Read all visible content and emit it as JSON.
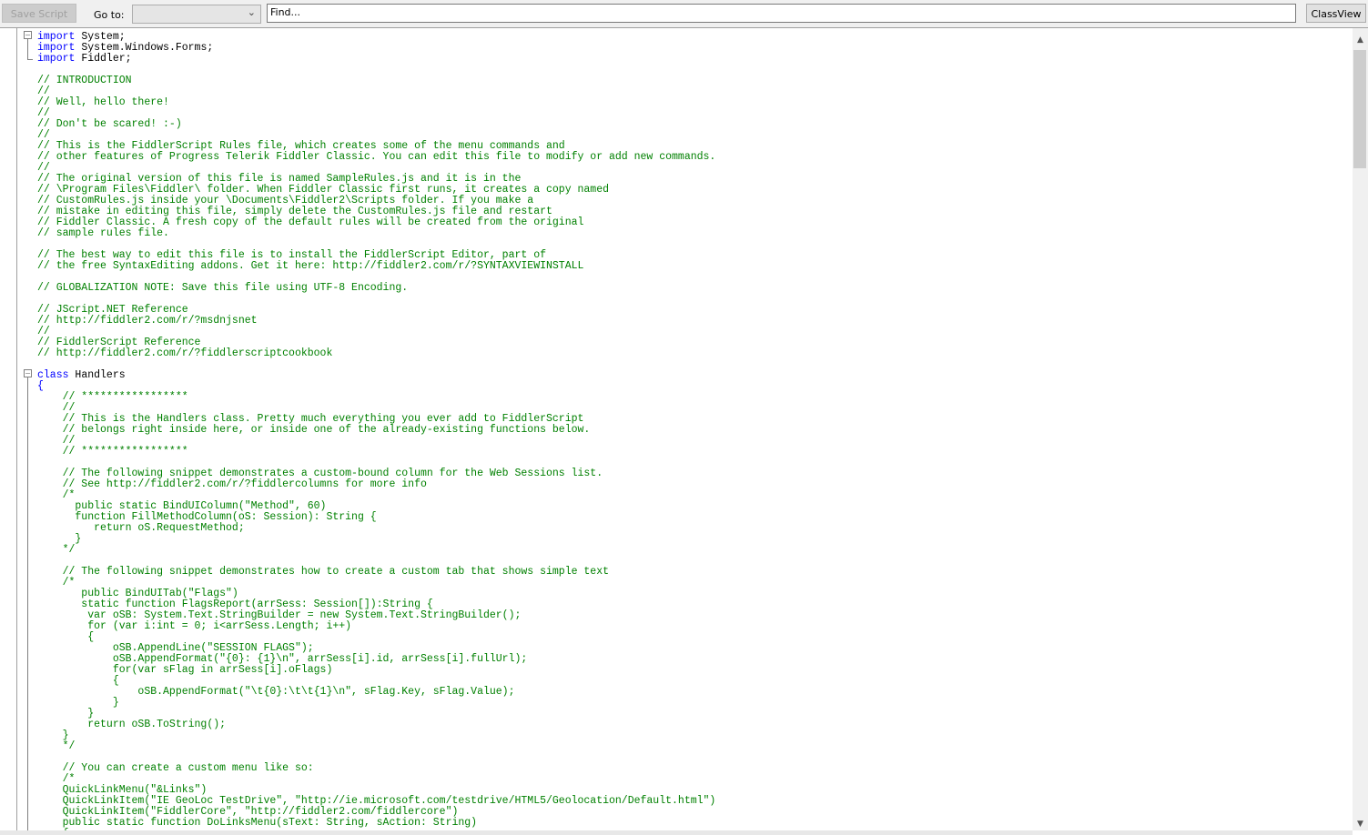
{
  "toolbar": {
    "save_label": "Save Script",
    "goto_label": "Go to:",
    "goto_value": "",
    "find_placeholder": "Find...",
    "classview_label": "ClassView"
  },
  "colors": {
    "keyword": "#0000ff",
    "comment": "#008000",
    "text": "#000000"
  },
  "editor": {
    "lines": [
      {
        "k": "import",
        "t": " System;",
        "c": ""
      },
      {
        "k": "import",
        "t": " System.Windows.Forms;",
        "c": ""
      },
      {
        "k": "import",
        "t": " Fiddler;",
        "c": ""
      },
      {
        "k": "",
        "t": "",
        "c": ""
      },
      {
        "k": "",
        "t": "",
        "c": "// INTRODUCTION"
      },
      {
        "k": "",
        "t": "",
        "c": "//"
      },
      {
        "k": "",
        "t": "",
        "c": "// Well, hello there!"
      },
      {
        "k": "",
        "t": "",
        "c": "//"
      },
      {
        "k": "",
        "t": "",
        "c": "// Don't be scared! :-)"
      },
      {
        "k": "",
        "t": "",
        "c": "//"
      },
      {
        "k": "",
        "t": "",
        "c": "// This is the FiddlerScript Rules file, which creates some of the menu commands and"
      },
      {
        "k": "",
        "t": "",
        "c": "// other features of Progress Telerik Fiddler Classic. You can edit this file to modify or add new commands."
      },
      {
        "k": "",
        "t": "",
        "c": "//"
      },
      {
        "k": "",
        "t": "",
        "c": "// The original version of this file is named SampleRules.js and it is in the"
      },
      {
        "k": "",
        "t": "",
        "c": "// \\Program Files\\Fiddler\\ folder. When Fiddler Classic first runs, it creates a copy named"
      },
      {
        "k": "",
        "t": "",
        "c": "// CustomRules.js inside your \\Documents\\Fiddler2\\Scripts folder. If you make a"
      },
      {
        "k": "",
        "t": "",
        "c": "// mistake in editing this file, simply delete the CustomRules.js file and restart"
      },
      {
        "k": "",
        "t": "",
        "c": "// Fiddler Classic. A fresh copy of the default rules will be created from the original"
      },
      {
        "k": "",
        "t": "",
        "c": "// sample rules file."
      },
      {
        "k": "",
        "t": "",
        "c": ""
      },
      {
        "k": "",
        "t": "",
        "c": "// The best way to edit this file is to install the FiddlerScript Editor, part of"
      },
      {
        "k": "",
        "t": "",
        "c": "// the free SyntaxEditing addons. Get it here: http://fiddler2.com/r/?SYNTAXVIEWINSTALL"
      },
      {
        "k": "",
        "t": "",
        "c": ""
      },
      {
        "k": "",
        "t": "",
        "c": "// GLOBALIZATION NOTE: Save this file using UTF-8 Encoding."
      },
      {
        "k": "",
        "t": "",
        "c": ""
      },
      {
        "k": "",
        "t": "",
        "c": "// JScript.NET Reference"
      },
      {
        "k": "",
        "t": "",
        "c": "// http://fiddler2.com/r/?msdnjsnet"
      },
      {
        "k": "",
        "t": "",
        "c": "//"
      },
      {
        "k": "",
        "t": "",
        "c": "// FiddlerScript Reference"
      },
      {
        "k": "",
        "t": "",
        "c": "// http://fiddler2.com/r/?fiddlerscriptcookbook"
      },
      {
        "k": "",
        "t": "",
        "c": ""
      },
      {
        "k": "class",
        "t": " Handlers",
        "c": ""
      },
      {
        "k": "{",
        "t": "",
        "c": ""
      },
      {
        "k": "",
        "t": "",
        "c": "    // *****************"
      },
      {
        "k": "",
        "t": "",
        "c": "    //"
      },
      {
        "k": "",
        "t": "",
        "c": "    // This is the Handlers class. Pretty much everything you ever add to FiddlerScript"
      },
      {
        "k": "",
        "t": "",
        "c": "    // belongs right inside here, or inside one of the already-existing functions below."
      },
      {
        "k": "",
        "t": "",
        "c": "    //"
      },
      {
        "k": "",
        "t": "",
        "c": "    // *****************"
      },
      {
        "k": "",
        "t": "",
        "c": ""
      },
      {
        "k": "",
        "t": "",
        "c": "    // The following snippet demonstrates a custom-bound column for the Web Sessions list."
      },
      {
        "k": "",
        "t": "",
        "c": "    // See http://fiddler2.com/r/?fiddlercolumns for more info"
      },
      {
        "k": "",
        "t": "",
        "c": "    /*"
      },
      {
        "k": "",
        "t": "",
        "c": "      public static BindUIColumn(\"Method\", 60)"
      },
      {
        "k": "",
        "t": "",
        "c": "      function FillMethodColumn(oS: Session): String {"
      },
      {
        "k": "",
        "t": "",
        "c": "         return oS.RequestMethod;"
      },
      {
        "k": "",
        "t": "",
        "c": "      }"
      },
      {
        "k": "",
        "t": "",
        "c": "    */"
      },
      {
        "k": "",
        "t": "",
        "c": ""
      },
      {
        "k": "",
        "t": "",
        "c": "    // The following snippet demonstrates how to create a custom tab that shows simple text"
      },
      {
        "k": "",
        "t": "",
        "c": "    /*"
      },
      {
        "k": "",
        "t": "",
        "c": "       public BindUITab(\"Flags\")"
      },
      {
        "k": "",
        "t": "",
        "c": "       static function FlagsReport(arrSess: Session[]):String {"
      },
      {
        "k": "",
        "t": "",
        "c": "        var oSB: System.Text.StringBuilder = new System.Text.StringBuilder();"
      },
      {
        "k": "",
        "t": "",
        "c": "        for (var i:int = 0; i<arrSess.Length; i++)"
      },
      {
        "k": "",
        "t": "",
        "c": "        {"
      },
      {
        "k": "",
        "t": "",
        "c": "            oSB.AppendLine(\"SESSION FLAGS\");"
      },
      {
        "k": "",
        "t": "",
        "c": "            oSB.AppendFormat(\"{0}: {1}\\n\", arrSess[i].id, arrSess[i].fullUrl);"
      },
      {
        "k": "",
        "t": "",
        "c": "            for(var sFlag in arrSess[i].oFlags)"
      },
      {
        "k": "",
        "t": "",
        "c": "            {"
      },
      {
        "k": "",
        "t": "",
        "c": "                oSB.AppendFormat(\"\\t{0}:\\t\\t{1}\\n\", sFlag.Key, sFlag.Value);"
      },
      {
        "k": "",
        "t": "",
        "c": "            }"
      },
      {
        "k": "",
        "t": "",
        "c": "        }"
      },
      {
        "k": "",
        "t": "",
        "c": "        return oSB.ToString();"
      },
      {
        "k": "",
        "t": "",
        "c": "    }"
      },
      {
        "k": "",
        "t": "",
        "c": "    */"
      },
      {
        "k": "",
        "t": "",
        "c": ""
      },
      {
        "k": "",
        "t": "",
        "c": "    // You can create a custom menu like so:"
      },
      {
        "k": "",
        "t": "",
        "c": "    /*"
      },
      {
        "k": "",
        "t": "",
        "c": "    QuickLinkMenu(\"&Links\")"
      },
      {
        "k": "",
        "t": "",
        "c": "    QuickLinkItem(\"IE GeoLoc TestDrive\", \"http://ie.microsoft.com/testdrive/HTML5/Geolocation/Default.html\")"
      },
      {
        "k": "",
        "t": "",
        "c": "    QuickLinkItem(\"FiddlerCore\", \"http://fiddler2.com/fiddlercore\")"
      },
      {
        "k": "",
        "t": "",
        "c": "    public static function DoLinksMenu(sText: String, sAction: String)"
      },
      {
        "k": "",
        "t": "",
        "c": "    {"
      }
    ]
  }
}
